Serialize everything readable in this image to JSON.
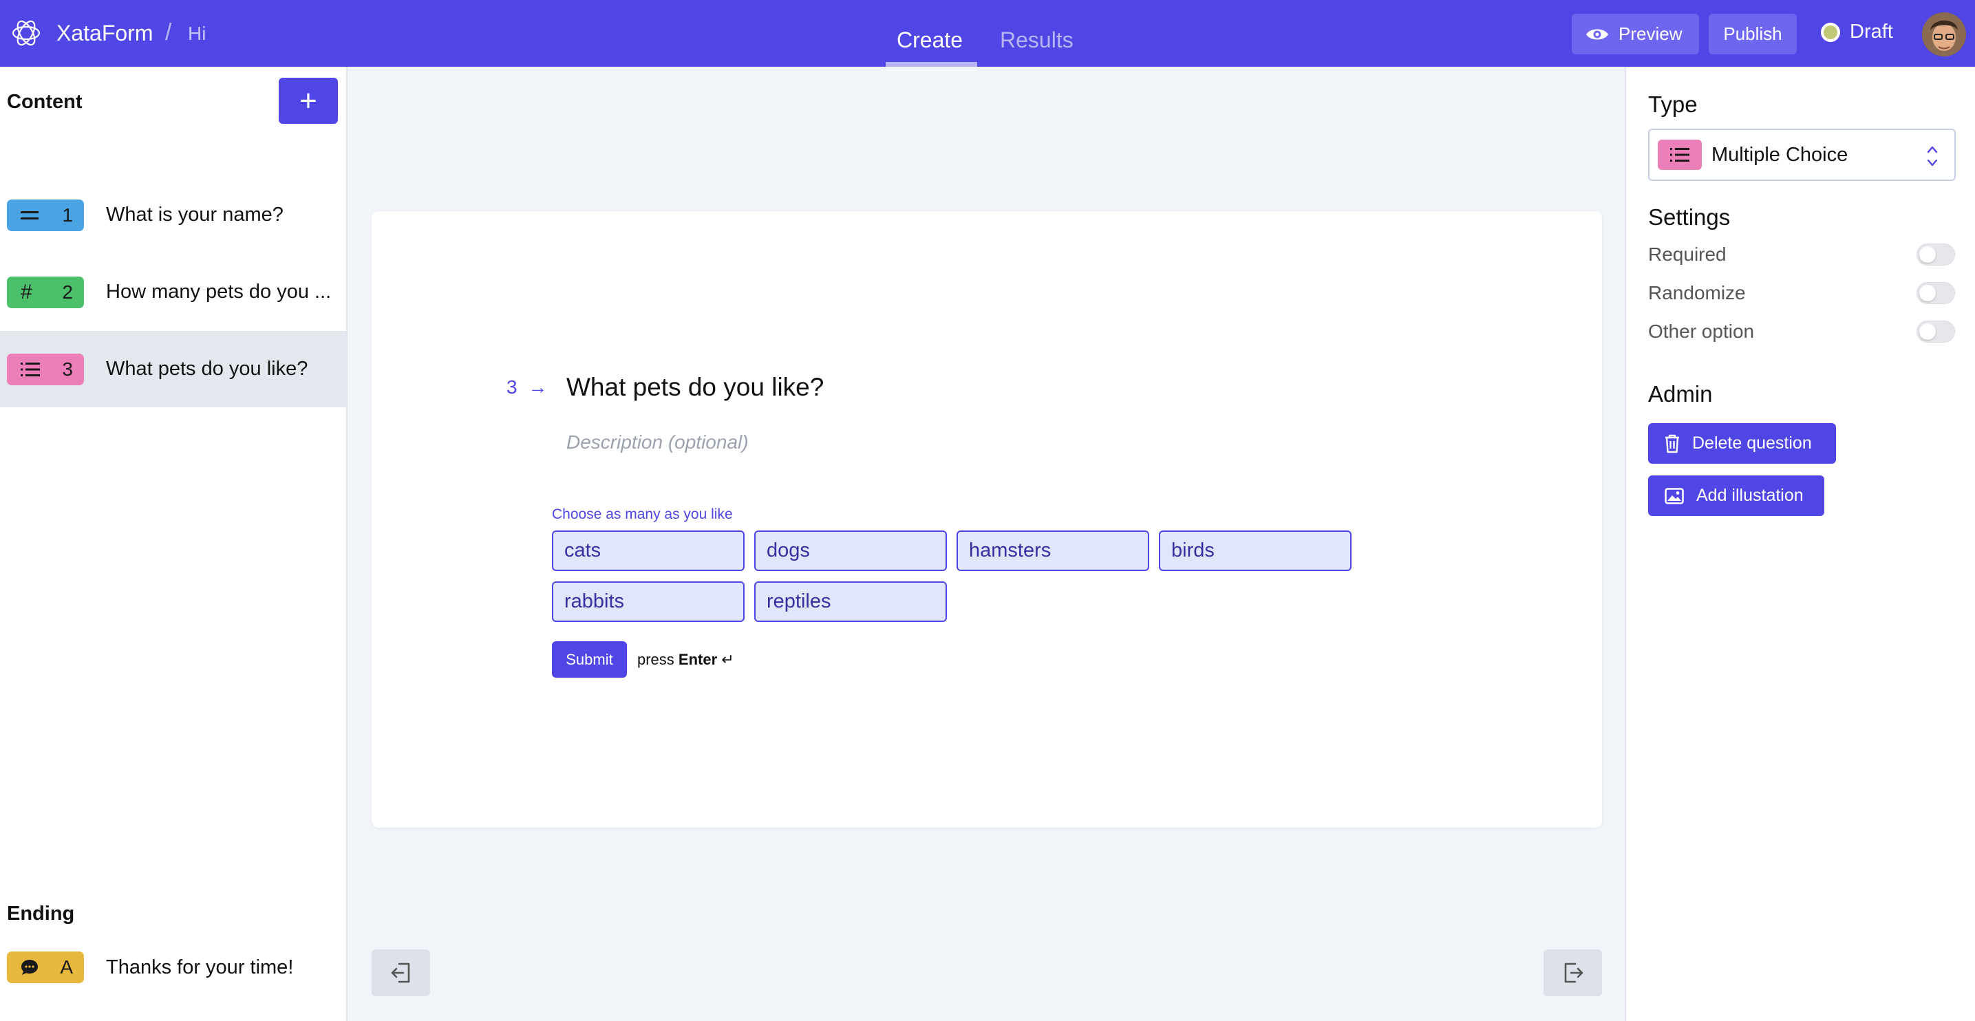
{
  "header": {
    "app_name": "XataForm",
    "separator": "/",
    "form_name": "Hi",
    "tabs": [
      {
        "label": "Create",
        "active": true
      },
      {
        "label": "Results",
        "active": false
      }
    ],
    "preview_label": "Preview",
    "publish_label": "Publish",
    "status_label": "Draft"
  },
  "sidebar": {
    "content_title": "Content",
    "add_label": "+",
    "questions": [
      {
        "number": "1",
        "icon": "text-lines-icon",
        "color": "#4aa3e3",
        "text": "What is your name?"
      },
      {
        "number": "2",
        "icon": "hash-icon",
        "color": "#4cc06a",
        "text": "How many pets do you ..."
      },
      {
        "number": "3",
        "icon": "list-icon",
        "color": "#ec7fb7",
        "text": "What pets do you like?"
      }
    ],
    "ending_title": "Ending",
    "ending": {
      "letter": "A",
      "icon": "chat-bubble-icon",
      "color": "#e8b83e",
      "text": "Thanks for your time!"
    }
  },
  "question": {
    "number": "3",
    "title": "What pets do you like?",
    "description_placeholder": "Description (optional)",
    "hint": "Choose as many as you like",
    "choices": [
      "cats",
      "dogs",
      "hamsters",
      "birds",
      "rabbits",
      "reptiles"
    ],
    "submit_label": "Submit",
    "press_label": "press",
    "enter_label": "Enter",
    "enter_symbol": "↵"
  },
  "panel": {
    "type_title": "Type",
    "type_value": "Multiple Choice",
    "settings_title": "Settings",
    "settings": [
      {
        "label": "Required",
        "enabled": false
      },
      {
        "label": "Randomize",
        "enabled": false
      },
      {
        "label": "Other option",
        "enabled": false
      }
    ],
    "admin_title": "Admin",
    "delete_label": "Delete question",
    "illustration_label": "Add illustation"
  },
  "colors": {
    "accent": "#4f46e5",
    "choice_bg": "#e2e6fb",
    "canvas_bg": "#f1f4f9"
  }
}
